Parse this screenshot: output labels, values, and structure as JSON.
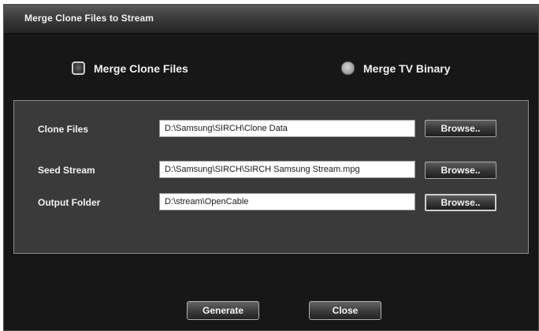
{
  "window": {
    "title": "Merge Clone Files to Stream"
  },
  "mode_options": [
    {
      "label": "Merge Clone Files",
      "selected": true
    },
    {
      "label": "Merge TV Binary",
      "selected": false
    }
  ],
  "fields": {
    "clone_files": {
      "label": "Clone Files",
      "value": "D:\\Samsung\\SIRCH\\Clone Data",
      "browse_label": "Browse.."
    },
    "seed_stream": {
      "label": "Seed Stream",
      "value": "D:\\Samsung\\SIRCH\\SIRCH Samsung Stream.mpg",
      "browse_label": "Browse.."
    },
    "output_folder": {
      "label": "Output Folder",
      "value": "D:\\stream\\OpenCable",
      "browse_label": "Browse.."
    }
  },
  "actions": {
    "generate_label": "Generate",
    "close_label": "Close"
  }
}
